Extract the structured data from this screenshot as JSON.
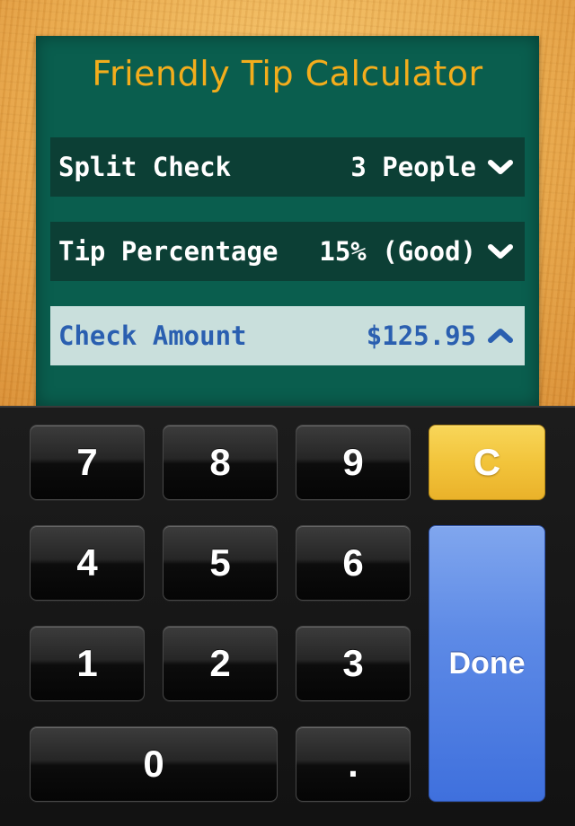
{
  "app": {
    "title": "Friendly Tip Calculator"
  },
  "rows": [
    {
      "label": "Split Check",
      "value": "3 People",
      "chevron": "chevron-down"
    },
    {
      "label": "Tip Percentage",
      "value": "15% (Good)",
      "chevron": "chevron-down"
    },
    {
      "label": "Check Amount",
      "value": "$125.95",
      "chevron": "chevron-up",
      "active": true
    }
  ],
  "keypad": {
    "keys": [
      "7",
      "8",
      "9",
      "C",
      "4",
      "5",
      "6",
      "1",
      "2",
      "3",
      "0",
      "."
    ],
    "done_label": "Done"
  },
  "colors": {
    "board": "#0a5e4e",
    "title": "#f3ad1c",
    "row": "#0c3f35",
    "active_row": "#c9dfdc",
    "active_text": "#2a5fb0",
    "clear_key": "#f2c43b",
    "done_key": "#5d8ae6"
  }
}
